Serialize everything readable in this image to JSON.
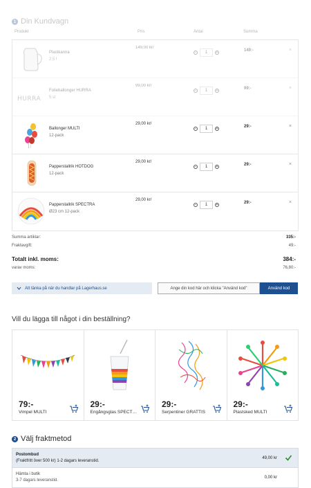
{
  "cart": {
    "step": "1",
    "title": "Din Kundvagn",
    "columns": {
      "product": "Produkt",
      "price": "Pris",
      "qty": "Antal",
      "sum": "Summa"
    },
    "items": [
      {
        "name": "Plastkanna",
        "sub": "2,5 l",
        "price": "149,00 kr/",
        "qty": "1",
        "sum": "149:-",
        "icon": "jug-image"
      },
      {
        "name": "Folieballonger HURRA",
        "sub": "5 st",
        "price": "99,00 kr/",
        "qty": "1",
        "sum": "99:-",
        "icon": "hurra-balloons-image"
      },
      {
        "name": "Ballonger MULTI",
        "sub": "12-pack",
        "price": "29,00 kr/",
        "qty": "1",
        "sum": "29:-",
        "icon": "balloons-image"
      },
      {
        "name": "Papperstallrik HOTDOG",
        "sub": "12-pack",
        "price": "29,00 kr/",
        "qty": "1",
        "sum": "29:-",
        "icon": "hotdog-plate-image"
      },
      {
        "name": "Papperstallrik SPECTRA",
        "sub": "Ø23 cm 12-pack",
        "price": "29,00 kr/",
        "qty": "1",
        "sum": "29:-",
        "icon": "spectra-plate-image"
      }
    ],
    "remove_glyph": "×",
    "minus_glyph": "−",
    "plus_glyph": "+"
  },
  "totals": {
    "articles_label": "Summa artiklar:",
    "articles_value": "335:-",
    "shipping_label": "Fraktavgift:",
    "shipping_value": "49:-",
    "total_label": "Totalt inkl. moms:",
    "total_value": "384:-",
    "vat_label": "varav moms:",
    "vat_value": "76,80:-"
  },
  "code": {
    "tip": "Att tänka på när du handlar på Lagerhaus.se",
    "placeholder": "Ange din kod här och klicka \"Använd kod\"",
    "button": "Använd kod"
  },
  "suggestions": {
    "title": "Vill du lägga till något i din beställning?",
    "items": [
      {
        "price": "79:-",
        "name": "Vimpel MULTI"
      },
      {
        "price": "29:-",
        "name": "Engångsglas SPECTRA"
      },
      {
        "price": "29:-",
        "name": "Serpentiner GRATTIS"
      },
      {
        "price": "29:-",
        "name": "Plastsked MULTI"
      }
    ]
  },
  "shipping": {
    "step": "2",
    "title": "Välj fraktmetod",
    "options": [
      {
        "name": "Postombud",
        "desc": "(Fraktfritt över 500 kr) 1-2 dagars leveranstid.",
        "price": "49,00 kr",
        "selected": true
      },
      {
        "name": "Hämta i butik",
        "desc": "3-7 dagars leveranstid.",
        "price": "0,00 kr",
        "selected": false
      }
    ]
  },
  "colors": {
    "accent": "#1d4f91",
    "highlight": "#e4ebf3",
    "check": "#2e8b2e"
  }
}
